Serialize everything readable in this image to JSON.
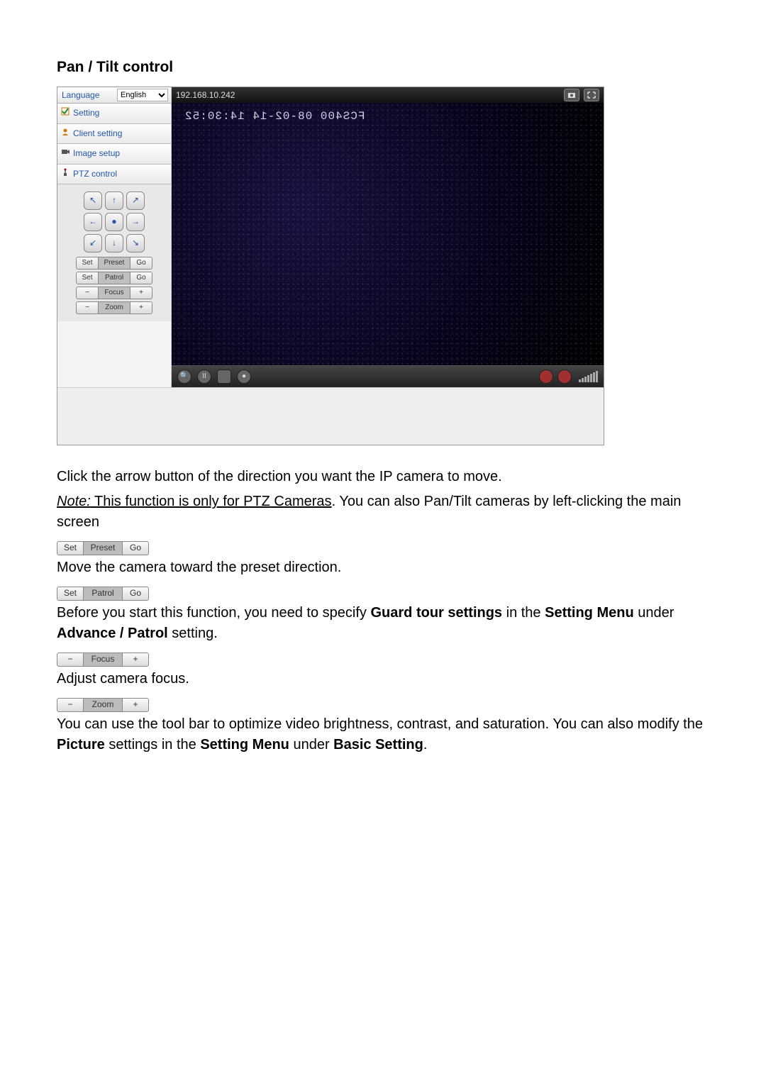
{
  "section_title": "Pan / Tilt control",
  "language": {
    "label": "Language",
    "value": "English"
  },
  "nav": {
    "setting": "Setting",
    "client_setting": "Client setting",
    "image_setup": "Image setup",
    "ptz_control": "PTZ control"
  },
  "ptz": {
    "preset": {
      "set": "Set",
      "label": "Preset",
      "go": "Go"
    },
    "patrol": {
      "set": "Set",
      "label": "Patrol",
      "go": "Go"
    },
    "focus": {
      "minus": "−",
      "label": "Focus",
      "plus": "+"
    },
    "zoom": {
      "minus": "−",
      "label": "Zoom",
      "plus": "+"
    }
  },
  "address_bar": "192.168.10.242",
  "osd_text": "FCS400 08-02-14 14:30:52",
  "body": {
    "p1": "Click the arrow button of the direction you want the IP camera to move.",
    "note_label": "Note:",
    "note_underline": " This function is only for PTZ Cameras",
    "note_rest": ". You can also Pan/Tilt cameras by left-clicking the main screen",
    "preset_text": "Move the camera toward the preset direction.",
    "patrol_text_a": "Before you start this function, you need to specify ",
    "patrol_bold_1": "Guard tour settings",
    "patrol_text_b": " in the ",
    "patrol_bold_2": "Setting Menu",
    "patrol_text_c": " under ",
    "patrol_bold_3": "Advance / Patrol",
    "patrol_text_d": " setting.",
    "focus_text": "Adjust camera focus.",
    "tail_a": "You can use the tool bar to optimize video brightness, contrast, and saturation. You can also modify the ",
    "tail_b1": "Picture",
    "tail_b": " settings in the ",
    "tail_b2": "Setting Menu",
    "tail_c": " under ",
    "tail_b3": "Basic Setting",
    "tail_d": "."
  },
  "inline_controls": {
    "preset": {
      "a": "Set",
      "b": "Preset",
      "c": "Go"
    },
    "patrol": {
      "a": "Set",
      "b": "Patrol",
      "c": "Go"
    },
    "focus": {
      "a": "−",
      "b": "Focus",
      "c": "+"
    },
    "zoom": {
      "a": "−",
      "b": "Zoom",
      "c": "+"
    }
  }
}
